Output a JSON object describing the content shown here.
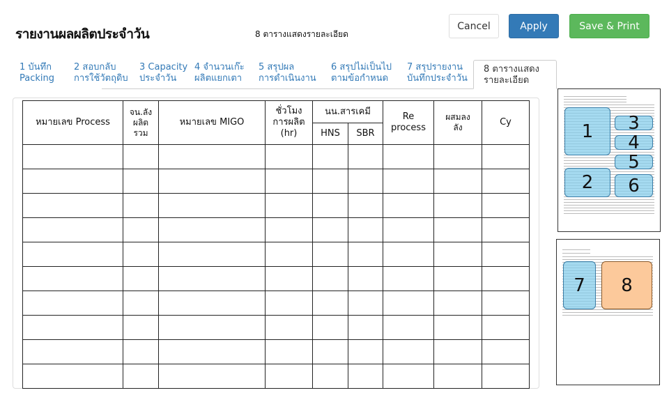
{
  "page": {
    "title": "รายงานผลผลิตประจำวัน",
    "subtitle": "8 ตารางแสดงรายละเอียด"
  },
  "buttons": {
    "cancel": "Cancel",
    "apply": "Apply",
    "save_print": "Save & Print"
  },
  "colors": {
    "apply": "#337ab7",
    "save_print": "#5cb85c",
    "tab_link": "#337ab7",
    "region_blue": "#87ceeb",
    "region_orange": "#fcc99b"
  },
  "tabs": [
    {
      "line1": "1 บันทึก",
      "line2": "Packing"
    },
    {
      "line1": "2 สอบกลับ",
      "line2": "การใช้วัตถุดิบ"
    },
    {
      "line1": "3 Capacity",
      "line2": "ประจำวัน"
    },
    {
      "line1": "4 จำนวนเก๊ะ",
      "line2": "ผลิตแยกเตา"
    },
    {
      "line1": "5 สรุปผล",
      "line2": "การดำเนินงาน"
    },
    {
      "line1": "6 สรุปไม่เป็นไป",
      "line2": "ตามข้อกำหนด"
    },
    {
      "line1": "7 สรุปรายงาน",
      "line2": "บันทึกประจำวัน"
    },
    {
      "line1": "8 ตารางแสดง",
      "line2": "รายละเอียด",
      "active": true
    }
  ],
  "table": {
    "headers": {
      "process_no": "หมายเลข Process",
      "total_cartons_l1": "จน.ลัง",
      "total_cartons_l2": "ผลิต",
      "total_cartons_l3": "รวม",
      "migo_no": "หมายเลข MIGO",
      "hours_l1": "ชั่วโมง",
      "hours_l2": "การผลิต",
      "hours_l3": "(hr)",
      "chem_weight": "นน.สารเคมี",
      "hns": "HNS",
      "sbr": "SBR",
      "reprocess_l1": "Re",
      "reprocess_l2": "process",
      "mixed_l1": "ผสมลง",
      "mixed_l2": "ลัง",
      "cy": "Cy"
    },
    "empty_rows": 10
  },
  "thumbnails": [
    {
      "name": "form-page-1",
      "regions": [
        "1",
        "2",
        "3",
        "4",
        "5",
        "6"
      ]
    },
    {
      "name": "form-page-2",
      "regions": [
        "7",
        "8"
      ]
    }
  ]
}
